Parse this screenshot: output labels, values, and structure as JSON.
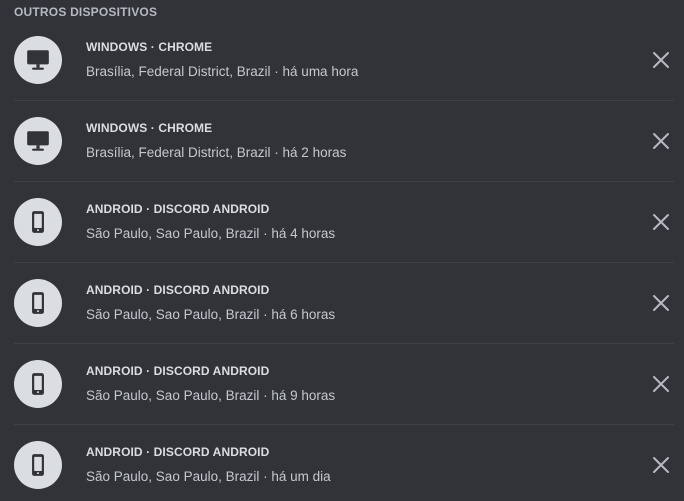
{
  "section": {
    "title": "OUTROS DISPOSITIVOS"
  },
  "sessions": [
    {
      "device": "WINDOWS · CHROME",
      "location": "Brasília, Federal District, Brazil · há uma hora",
      "icon": "desktop-icon"
    },
    {
      "device": "WINDOWS · CHROME",
      "location": "Brasília, Federal District, Brazil · há 2 horas",
      "icon": "desktop-icon"
    },
    {
      "device": "ANDROID · DISCORD ANDROID",
      "location": "São Paulo, Sao Paulo, Brazil · há 4 horas",
      "icon": "mobile-icon"
    },
    {
      "device": "ANDROID · DISCORD ANDROID",
      "location": "São Paulo, Sao Paulo, Brazil · há 6 horas",
      "icon": "mobile-icon"
    },
    {
      "device": "ANDROID · DISCORD ANDROID",
      "location": "São Paulo, Sao Paulo, Brazil · há 9 horas",
      "icon": "mobile-icon"
    },
    {
      "device": "ANDROID · DISCORD ANDROID",
      "location": "São Paulo, Sao Paulo, Brazil · há um dia",
      "icon": "mobile-icon"
    }
  ],
  "colors": {
    "background": "#313338",
    "avatar": "#dbdee1",
    "icon": "#313338",
    "text": "#dbdee1",
    "muted": "#b5bac1",
    "divider": "#3f4147"
  }
}
